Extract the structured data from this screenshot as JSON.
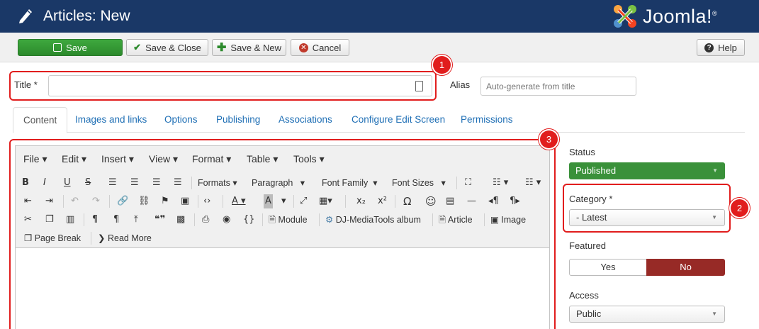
{
  "header": {
    "title": "Articles: New",
    "logo_text": "Joomla!",
    "logo_mark": "®",
    "bg_color": "#1a3867"
  },
  "toolbar": {
    "save": "Save",
    "save_close": "Save & Close",
    "save_new": "Save & New",
    "cancel": "Cancel",
    "help": "Help"
  },
  "form": {
    "title_label": "Title *",
    "title_value": "",
    "alias_label": "Alias",
    "alias_placeholder": "Auto-generate from title"
  },
  "tabs": [
    {
      "label": "Content",
      "active": true
    },
    {
      "label": "Images and links"
    },
    {
      "label": "Options"
    },
    {
      "label": "Publishing"
    },
    {
      "label": "Associations"
    },
    {
      "label": "Configure Edit Screen"
    },
    {
      "label": "Permissions"
    }
  ],
  "editor": {
    "menus": [
      "File",
      "Edit",
      "Insert",
      "View",
      "Format",
      "Table",
      "Tools"
    ],
    "formats": "Formats",
    "paragraph": "Paragraph",
    "font_family": "Font Family",
    "font_sizes": "Font Sizes",
    "module": "Module",
    "djmedia": "DJ-MediaTools album",
    "article": "Article",
    "image": "Image",
    "page_break": "Page Break",
    "read_more": "Read More",
    "curly": "{}"
  },
  "sidebar": {
    "status_label": "Status",
    "status_value": "Published",
    "category_label": "Category *",
    "category_value": "- Latest",
    "featured_label": "Featured",
    "featured_yes": "Yes",
    "featured_no": "No",
    "access_label": "Access",
    "access_value": "Public"
  },
  "callouts": [
    "1",
    "2",
    "3"
  ],
  "colors": {
    "save_green": "#3ea83e",
    "status_green": "#3a913a",
    "no_red": "#972a26",
    "callout_red": "#e11d1d",
    "link_blue": "#1f6fb5"
  }
}
